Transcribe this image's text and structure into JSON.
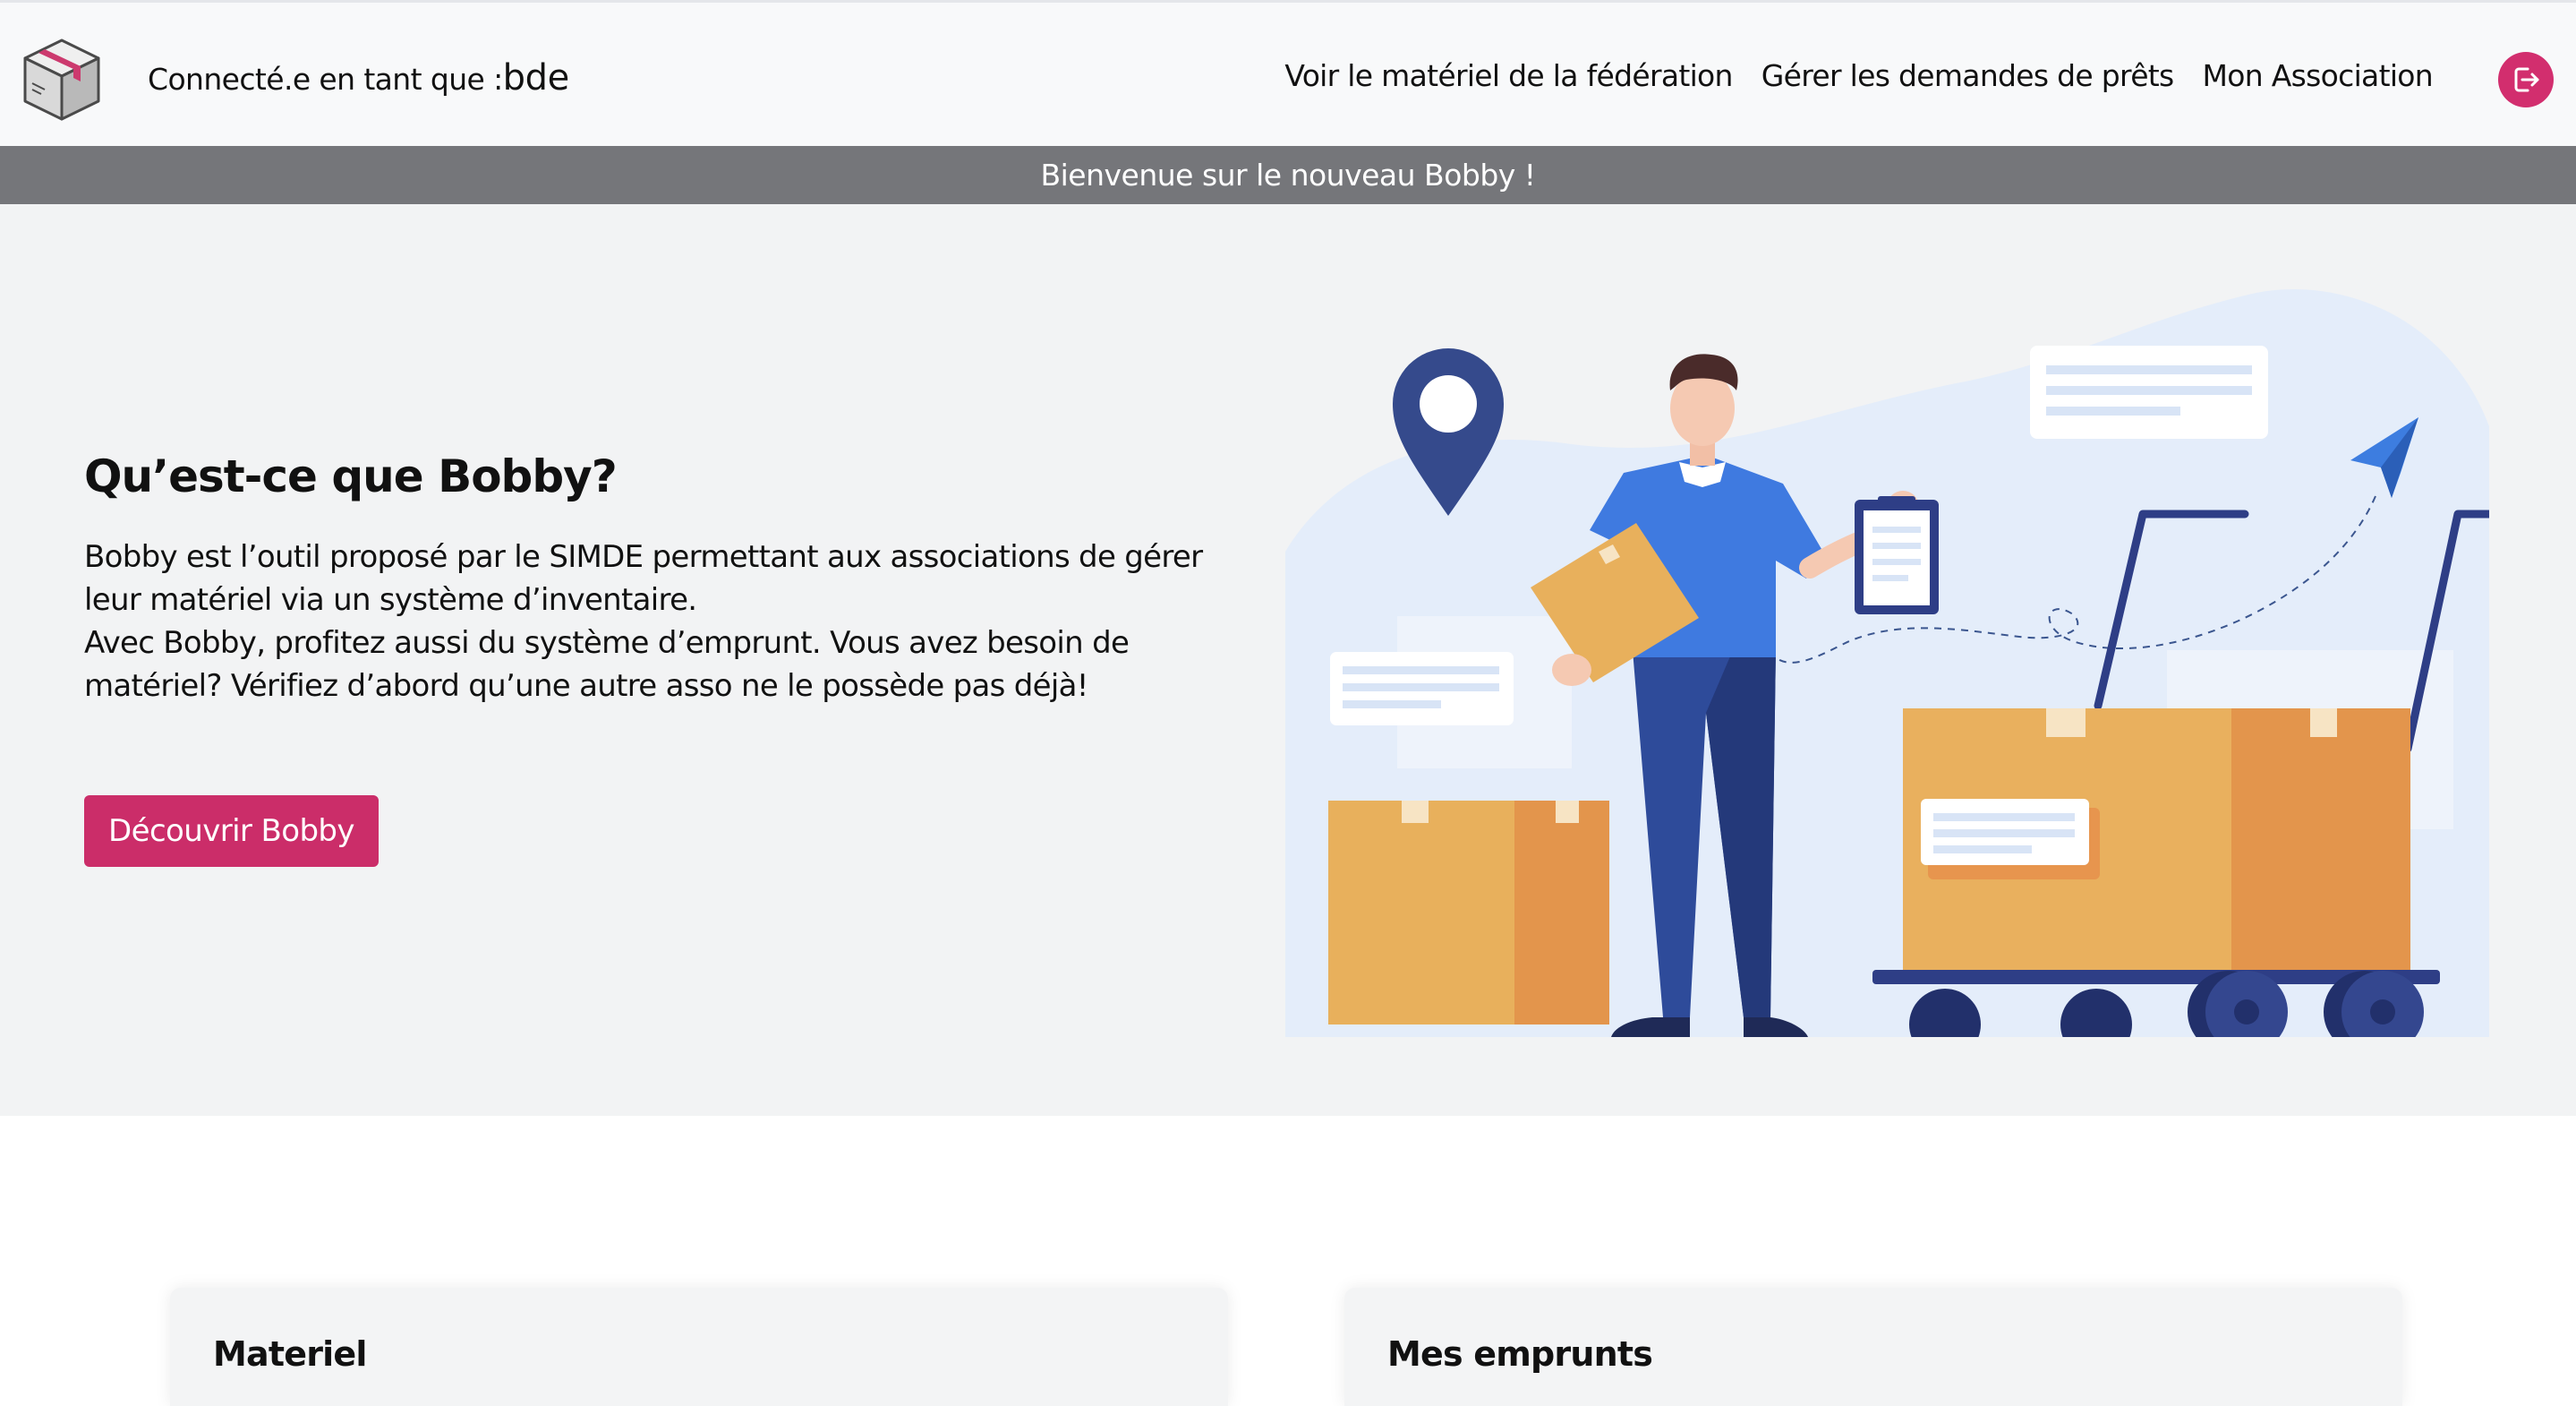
{
  "navbar": {
    "connected_prefix": "Connecté.e en tant que :",
    "username": "bde",
    "links": [
      {
        "label": "Voir le matériel de la fédération"
      },
      {
        "label": "Gérer les demandes de prêts"
      },
      {
        "label": "Mon Association"
      }
    ],
    "logout_icon": "logout-icon",
    "accent_color": "#cb2d69"
  },
  "banner": {
    "text": "Bienvenue sur le nouveau Bobby !"
  },
  "hero": {
    "title": "Qu’est-ce que Bobby?",
    "paragraph_1": "Bobby est l’outil proposé par le SIMDE permettant aux associations de gérer leur matériel via un système d’inventaire.",
    "paragraph_2": "Avec Bobby, profitez aussi du système d’emprunt. Vous avez besoin de matériel? Vérifiez d’abord qu’une autre asso ne le possède pas déjà!",
    "button_label": "Découvrir Bobby"
  },
  "cards": [
    {
      "title": "Materiel"
    },
    {
      "title": "Mes emprunts"
    }
  ]
}
